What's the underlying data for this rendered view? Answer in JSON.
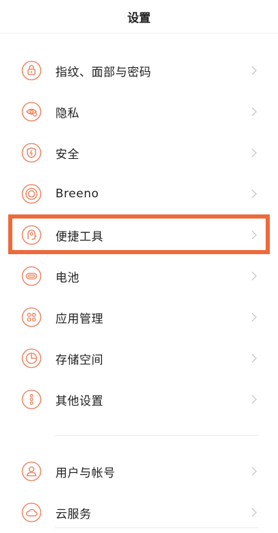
{
  "header": {
    "title": "设置"
  },
  "colors": {
    "icon_accent": "#ee8a6a",
    "highlight": "#ee6a3a",
    "chevron": "#c8c8c8"
  },
  "group1": [
    {
      "label": "指纹、面部与密码",
      "icon": "lock-icon"
    },
    {
      "label": "隐私",
      "icon": "privacy-eye-icon"
    },
    {
      "label": "安全",
      "icon": "shield-icon"
    },
    {
      "label": "Breeno",
      "icon": "breeno-ring-icon"
    },
    {
      "label": "便捷工具",
      "icon": "convenience-tool-icon"
    },
    {
      "label": "电池",
      "icon": "battery-icon"
    },
    {
      "label": "应用管理",
      "icon": "app-grid-icon"
    },
    {
      "label": "存储空间",
      "icon": "storage-pie-icon"
    },
    {
      "label": "其他设置",
      "icon": "more-dots-icon"
    }
  ],
  "group2": [
    {
      "label": "用户与帐号",
      "icon": "user-icon"
    },
    {
      "label": "云服务",
      "icon": "cloud-icon"
    }
  ]
}
